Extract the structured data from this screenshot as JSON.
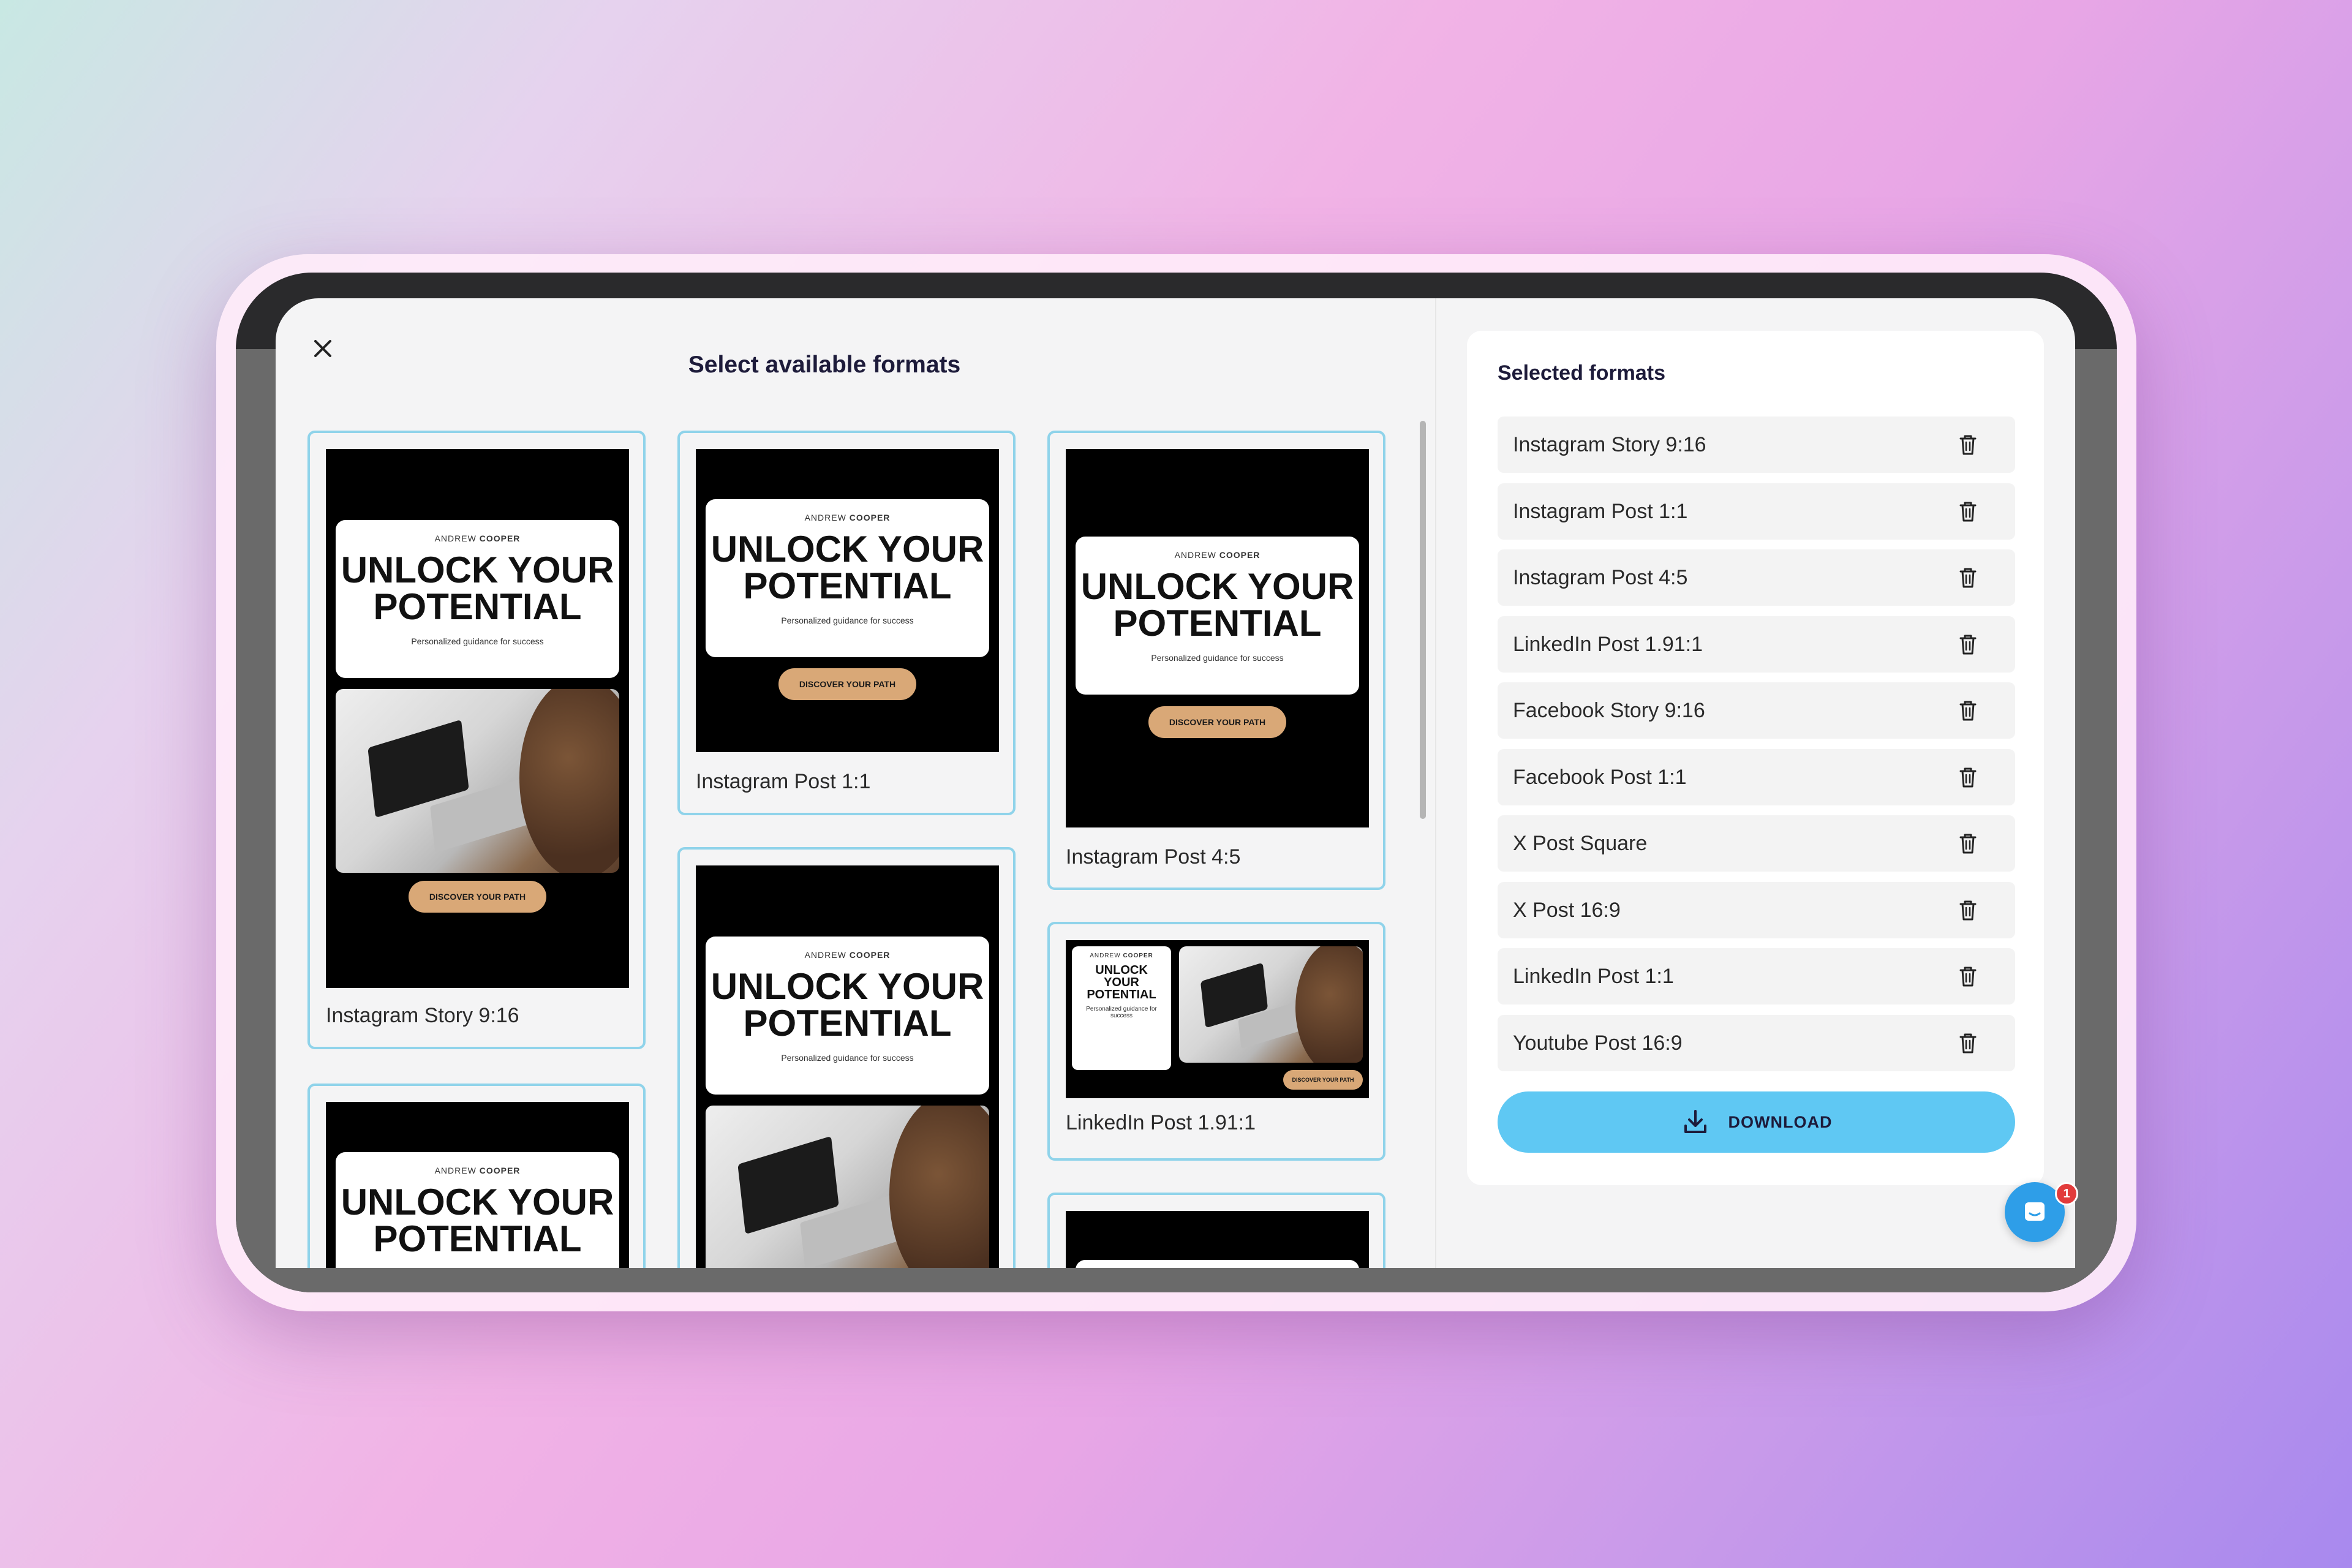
{
  "modal": {
    "title": "Select available formats",
    "close_icon": "close-icon"
  },
  "preview_content": {
    "author_first": "ANDREW",
    "author_last": "COOPER",
    "headline_line1": "UNLOCK YOUR",
    "headline_line2": "POTENTIAL",
    "headline_short_line1": "UNLOCK",
    "headline_short_line2": "YOUR",
    "headline_short_line3": "POTENTIAL",
    "subtitle": "Personalized guidance for success",
    "cta": "DISCOVER YOUR PATH"
  },
  "cards": [
    {
      "label": "Instagram Story 9:16"
    },
    {
      "label": "Instagram Post 1:1"
    },
    {
      "label": "Instagram Post 4:5"
    },
    {
      "label": "LinkedIn Post 1.91:1"
    }
  ],
  "selected_panel": {
    "title": "Selected formats",
    "formats": [
      "Instagram Story 9:16",
      "Instagram Post 1:1",
      "Instagram Post 4:5",
      "LinkedIn Post 1.91:1",
      "Facebook Story 9:16",
      "Facebook Post 1:1",
      "X Post Square",
      "X Post 16:9",
      "LinkedIn Post 1:1",
      "Youtube Post 16:9"
    ],
    "download_label": "DOWNLOAD"
  },
  "chat": {
    "badge_count": "1"
  },
  "colors": {
    "card_border": "#8fd3ea",
    "download_button": "#5fc8f3",
    "cta_button": "#d9a877",
    "chat_bubble": "#2e9ee8",
    "badge": "#e23b3b"
  }
}
